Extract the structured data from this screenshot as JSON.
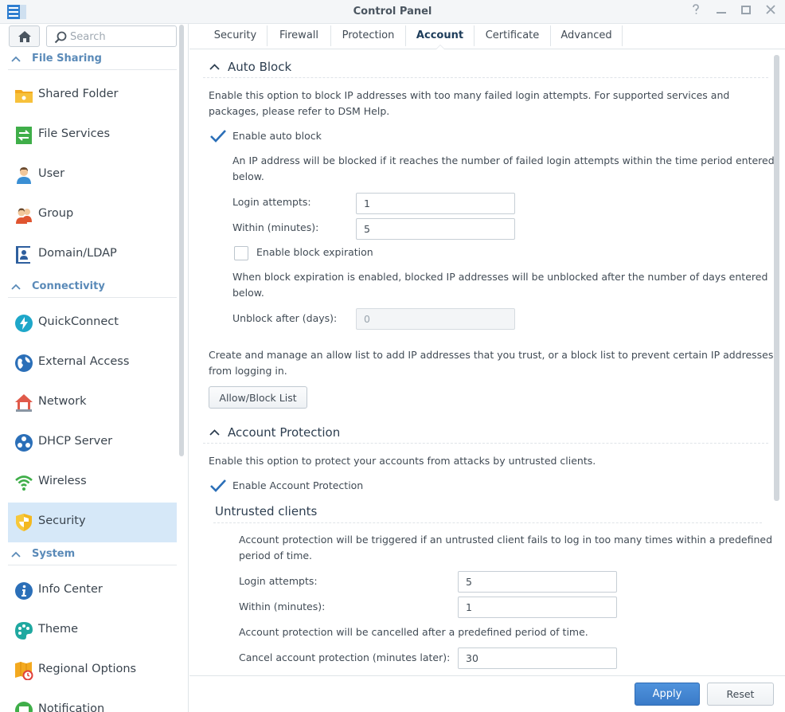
{
  "window": {
    "title": "Control Panel",
    "controls": [
      "help-icon",
      "minimize-icon",
      "maximize-icon",
      "close-icon"
    ]
  },
  "sidebar": {
    "search_placeholder": "Search",
    "groups": [
      {
        "label": "File Sharing",
        "items": [
          {
            "label": "Shared Folder",
            "icon": "shared-folder-icon"
          },
          {
            "label": "File Services",
            "icon": "file-services-icon"
          },
          {
            "label": "User",
            "icon": "user-icon"
          },
          {
            "label": "Group",
            "icon": "group-icon"
          },
          {
            "label": "Domain/LDAP",
            "icon": "domain-ldap-icon"
          }
        ]
      },
      {
        "label": "Connectivity",
        "items": [
          {
            "label": "QuickConnect",
            "icon": "quickconnect-icon"
          },
          {
            "label": "External Access",
            "icon": "external-access-icon"
          },
          {
            "label": "Network",
            "icon": "network-icon"
          },
          {
            "label": "DHCP Server",
            "icon": "dhcp-server-icon"
          },
          {
            "label": "Wireless",
            "icon": "wireless-icon"
          },
          {
            "label": "Security",
            "icon": "security-shield-icon",
            "active": true
          }
        ]
      },
      {
        "label": "System",
        "items": [
          {
            "label": "Info Center",
            "icon": "info-center-icon"
          },
          {
            "label": "Theme",
            "icon": "theme-palette-icon"
          },
          {
            "label": "Regional Options",
            "icon": "regional-options-icon"
          },
          {
            "label": "Notification",
            "icon": "notification-icon"
          }
        ]
      }
    ]
  },
  "tabs": [
    {
      "label": "Security"
    },
    {
      "label": "Firewall"
    },
    {
      "label": "Protection"
    },
    {
      "label": "Account",
      "active": true
    },
    {
      "label": "Certificate"
    },
    {
      "label": "Advanced"
    }
  ],
  "auto_block": {
    "title": "Auto Block",
    "description_1": "Enable this option to block IP addresses with too many failed login attempts. For supported services and",
    "description_2": "packages, please refer to DSM Help.",
    "enable_label": "Enable auto block",
    "enable_checked": true,
    "info_1": "An IP address will be blocked if it reaches the number of failed login attempts within the time period entered",
    "info_2": "below.",
    "login_attempts_label": "Login attempts:",
    "login_attempts_value": "1",
    "within_label": "Within (minutes):",
    "within_value": "5",
    "expiration_label": "Enable block expiration",
    "expiration_checked": false,
    "expiration_info_1": "When block expiration is enabled, blocked IP addresses will be unblocked after the number of days entered",
    "expiration_info_2": "below.",
    "unblock_label": "Unblock after (days):",
    "unblock_value": "0",
    "list_info_1": "Create and manage an allow list to add IP addresses that you trust, or a block list to prevent certain IP addresses",
    "list_info_2": "from logging in.",
    "list_button": "Allow/Block List"
  },
  "account_protection": {
    "title": "Account Protection",
    "description": "Enable this option to protect your accounts from attacks by untrusted clients.",
    "enable_label": "Enable Account Protection",
    "enable_checked": true,
    "untrusted_title": "Untrusted clients",
    "untrusted_info_1": "Account protection will be triggered if an untrusted client fails to log in too many times within a predefined",
    "untrusted_info_2": "period of time.",
    "login_attempts_label": "Login attempts:",
    "login_attempts_value": "5",
    "within_label": "Within (minutes):",
    "within_value": "1",
    "cancel_info": "Account protection will be cancelled after a predefined period of time.",
    "cancel_label": "Cancel account protection (minutes later):",
    "cancel_value": "30"
  },
  "footer": {
    "apply_label": "Apply",
    "reset_label": "Reset"
  },
  "colors": {
    "accent": "#3a7bc8",
    "active_nav": "#d6e8f8",
    "group_header": "#5a8ab8"
  }
}
